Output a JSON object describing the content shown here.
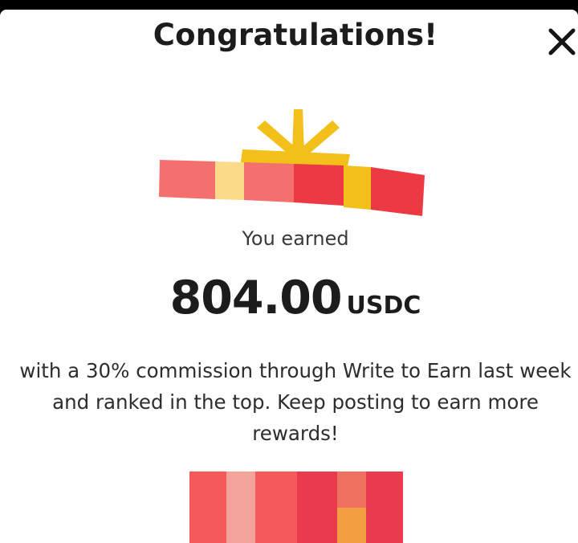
{
  "dialog": {
    "title": "Congratulations!",
    "close_icon": "close-icon",
    "earned_label": "You earned",
    "amount": "804.00",
    "currency": "USDC",
    "message": "with a 30% commission through Write to Earn last week\nand ranked in the top. Keep posting to earn more\nrewards!"
  },
  "colors": {
    "gift_red": "#ec3a45",
    "gift_coral": "#f4706e",
    "gift_yellow": "#f2c019",
    "gift_light_yellow": "#f9db8a"
  }
}
